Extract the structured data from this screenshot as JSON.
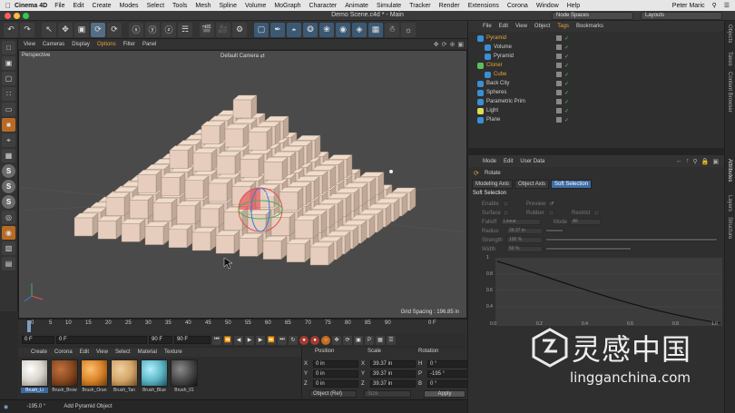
{
  "menubar": {
    "app_name": "Cinema 4D",
    "items": [
      "File",
      "Edit",
      "Create",
      "Modes",
      "Select",
      "Tools",
      "Mesh",
      "Spline",
      "Volume",
      "MoGraph",
      "Character",
      "Animate",
      "Simulate",
      "Tracker",
      "Render",
      "Extensions",
      "Corona",
      "Window",
      "Help"
    ],
    "user": "Peter Maric"
  },
  "window": {
    "title": "Demo Scene.c4d * - Main",
    "node_spaces": "Node Spaces",
    "layouts": "Layouts"
  },
  "viewport": {
    "menu": [
      "View",
      "Cameras",
      "Display",
      "Options",
      "Filter",
      "Panel"
    ],
    "highlighted_menu": "Options",
    "label": "Perspective",
    "camera": "Default Camera",
    "grid_spacing": "Grid Spacing : 196.85 in",
    "object_name_tag": "Cube"
  },
  "timeline": {
    "ticks": [
      "0",
      "5",
      "10",
      "15",
      "20",
      "25",
      "30",
      "35",
      "40",
      "45",
      "50",
      "55",
      "60",
      "65",
      "70",
      "75",
      "80",
      "85",
      "90"
    ],
    "end_frame": "0 F"
  },
  "playbar": {
    "current_frame": "0 F",
    "start_frame": "0 F",
    "preview_end": "90 F",
    "end_frame": "90 F"
  },
  "materials": {
    "menu": [
      "Create",
      "Corona",
      "Edit",
      "View",
      "Select",
      "Material",
      "Texture"
    ],
    "items": [
      {
        "name": "Brush_Li",
        "color": "#d9d4cc"
      },
      {
        "name": "Brush_Brow",
        "color": "#8a4a1f"
      },
      {
        "name": "Brush_Oran",
        "color": "#d9842a"
      },
      {
        "name": "Brush_Tan",
        "color": "#d4a56a"
      },
      {
        "name": "Brush_Blue",
        "color": "#5fb7c7"
      },
      {
        "name": "Brush_01",
        "color": "#4a4a4a"
      }
    ]
  },
  "coordinates": {
    "headers": {
      "position": "Position",
      "scale": "Scale",
      "rotation": "Rotation"
    },
    "rows": [
      {
        "axis": "X",
        "position": "0 in",
        "scale_axis": "X",
        "scale": "39.37 in",
        "rot_axis": "H",
        "rotation": "0 °"
      },
      {
        "axis": "Y",
        "position": "0 in",
        "scale_axis": "Y",
        "scale": "39.37 in",
        "rot_axis": "P",
        "rotation": "-195 °"
      },
      {
        "axis": "Z",
        "position": "0 in",
        "scale_axis": "Z",
        "scale": "39.37 in",
        "rot_axis": "B",
        "rotation": "0 °"
      }
    ],
    "mode": "Object (Rel)",
    "size_mode": "Size",
    "apply": "Apply"
  },
  "status": {
    "value": "-195.0 °",
    "message": "Add Pyramid Object"
  },
  "object_manager": {
    "menu": [
      "File",
      "Edit",
      "View",
      "Object",
      "Tags",
      "Bookmarks"
    ],
    "highlighted_menu": "Tags",
    "objects": [
      {
        "name": "Pyramid",
        "indent": 0,
        "color": "#e8a33c",
        "icon": "#3a8fd6"
      },
      {
        "name": "Volume",
        "indent": 1,
        "color": "#cfcfcf",
        "icon": "#3a8fd6"
      },
      {
        "name": "Pyramid",
        "indent": 1,
        "color": "#cfcfcf",
        "icon": "#3a8fd6"
      },
      {
        "name": "Cloner",
        "indent": 0,
        "color": "#e8a33c",
        "icon": "#5bc05b"
      },
      {
        "name": "Cube",
        "indent": 1,
        "color": "#e8a33c",
        "icon": "#3a8fd6"
      },
      {
        "name": "Back City",
        "indent": 0,
        "color": "#cfcfcf",
        "icon": "#3a8fd6"
      },
      {
        "name": "Spheres",
        "indent": 0,
        "color": "#cfcfcf",
        "icon": "#3a8fd6"
      },
      {
        "name": "Parametric Prim",
        "indent": 0,
        "color": "#cfcfcf",
        "icon": "#3a8fd6"
      },
      {
        "name": "Light",
        "indent": 0,
        "color": "#cfcfcf",
        "icon": "#dddd55"
      },
      {
        "name": "Plane",
        "indent": 0,
        "color": "#cfcfcf",
        "icon": "#3a8fd6"
      }
    ]
  },
  "attributes": {
    "menu": [
      "Mode",
      "Edit",
      "User Data"
    ],
    "tool": "Rotate",
    "tabs": [
      "Modeling Axis",
      "Object Axis",
      "Soft Selection"
    ],
    "active_tab": "Soft Selection",
    "section": "Soft Selection",
    "props": {
      "enable": "Enable",
      "preview": "Preview",
      "surface": "Surface",
      "rubber": "Rubber",
      "restrict": "Restrict",
      "falloff": "Falloff",
      "falloff_value": "Linear",
      "mode": "Mode",
      "mode_value": "All",
      "radius": "Radius",
      "radius_value": "39.37 in",
      "strength": "Strength",
      "strength_value": "100 %",
      "width": "Width",
      "width_value": "50 %"
    },
    "graph": {
      "y_labels": [
        "1",
        "0.8",
        "0.6",
        "0.4"
      ],
      "x_labels": [
        "0.0",
        "0.2",
        "0.4",
        "0.6",
        "0.8",
        "1.0"
      ]
    }
  },
  "right_tabs": [
    "Objects",
    "Takes",
    "Content Browser",
    "Attributes",
    "Layers",
    "Structure"
  ],
  "watermark": {
    "cn": "灵感中国",
    "en": "lingganchina.com"
  },
  "colors": {
    "accent_orange": "#e8a33c",
    "selection_blue": "#3f6da6"
  }
}
